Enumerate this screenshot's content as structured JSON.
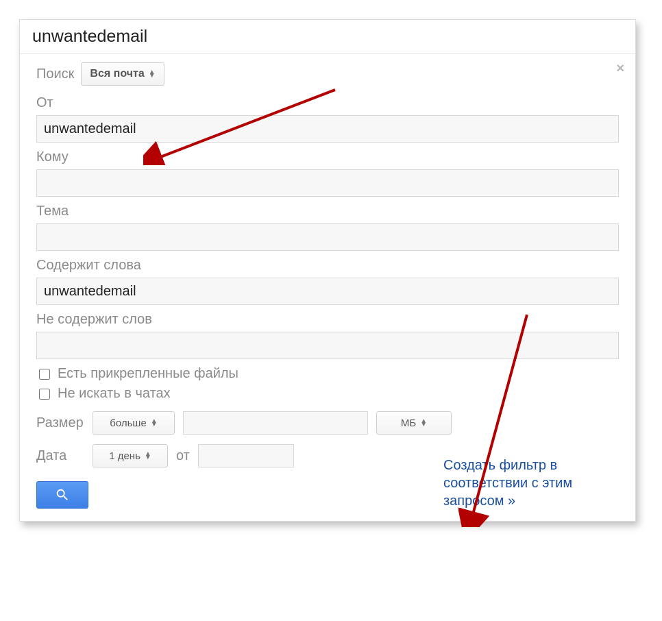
{
  "top_search_value": "unwantedemail",
  "search_scope_label": "Поиск",
  "search_scope_value": "Вся почта",
  "close_icon": "×",
  "fields": {
    "from": {
      "label": "От",
      "value": "unwantedemail"
    },
    "to": {
      "label": "Кому",
      "value": ""
    },
    "subject": {
      "label": "Тема",
      "value": ""
    },
    "has_words": {
      "label": "Содержит слова",
      "value": "unwantedemail"
    },
    "not_has_words": {
      "label": "Не содержит слов",
      "value": ""
    }
  },
  "checkboxes": {
    "has_attachments": {
      "label": "Есть прикрепленные файлы",
      "checked": false
    },
    "exclude_chats": {
      "label": "Не искать в чатах",
      "checked": false
    }
  },
  "size": {
    "label": "Размер",
    "comparator": "больше",
    "value": "",
    "unit": "МБ"
  },
  "date": {
    "label": "Дата",
    "range": "1 день",
    "from_label": "от",
    "from_value": ""
  },
  "create_filter_link": "Создать фильтр в соответствии с этим запросом »"
}
